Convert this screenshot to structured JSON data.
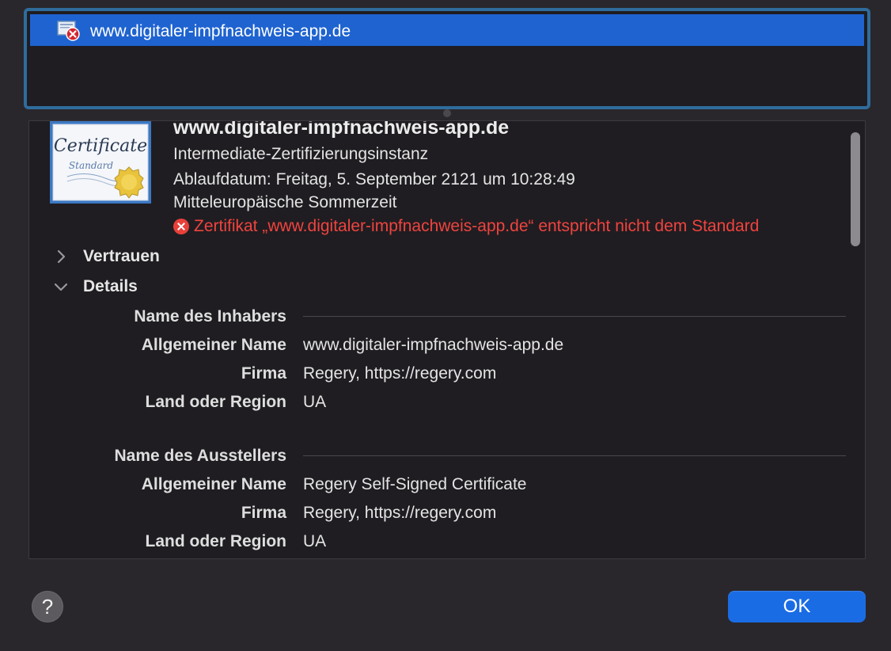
{
  "certificate_list": {
    "items": [
      {
        "label": "www.digitaler-impfnachweis-app.de",
        "icon": "certificate-error-icon",
        "selected": true
      }
    ]
  },
  "certificate": {
    "image_text_main": "Certificate",
    "image_text_sub": "Standard",
    "title": "www.digitaler-impfnachweis-app.de",
    "type": "Intermediate-Zertifizierungsinstanz",
    "expiry_line1": "Ablaufdatum: Freitag, 5. September 2121 um 10:28:49",
    "expiry_line2": "Mitteleuropäische Sommerzeit",
    "error_message": "Zertifikat „www.digitaler-impfnachweis-app.de“ entspricht nicht dem Standard"
  },
  "sections": {
    "trust": {
      "label": "Vertrauen",
      "expanded": false
    },
    "details": {
      "label": "Details",
      "expanded": true
    }
  },
  "subject": {
    "header": "Name des Inhabers",
    "fields": [
      {
        "label": "Allgemeiner Name",
        "value": "www.digitaler-impfnachweis-app.de"
      },
      {
        "label": "Firma",
        "value": "Regery, https://regery.com"
      },
      {
        "label": "Land oder Region",
        "value": "UA"
      }
    ]
  },
  "issuer": {
    "header": "Name des Ausstellers",
    "fields": [
      {
        "label": "Allgemeiner Name",
        "value": "Regery Self-Signed Certificate"
      },
      {
        "label": "Firma",
        "value": "Regery, https://regery.com"
      },
      {
        "label": "Land oder Region",
        "value": "UA"
      }
    ]
  },
  "buttons": {
    "help_label": "?",
    "ok_label": "OK"
  },
  "colors": {
    "selection": "#1e63d0",
    "error": "#f0433f",
    "ok_button": "#1a6ce5"
  }
}
